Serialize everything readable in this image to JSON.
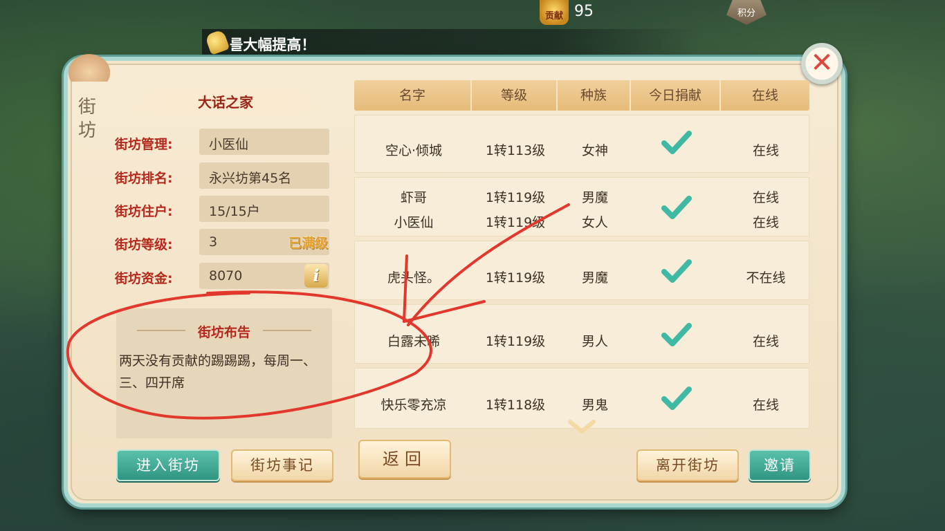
{
  "top": {
    "contribution_icon_label": "贡献",
    "contribution_value": "95",
    "score_icon_label": "积分"
  },
  "broadcast": {
    "text": "를大幅提高！"
  },
  "panel": {
    "side_title": "街坊",
    "home_name": "大话之家",
    "info": [
      {
        "label": "街坊管理:",
        "value": "小医仙"
      },
      {
        "label": "街坊排名:",
        "value": "永兴坊第45名"
      },
      {
        "label": "街坊住户:",
        "value": "15/15户"
      },
      {
        "label": "街坊等级:",
        "value": "3",
        "tag": "已满级"
      },
      {
        "label": "街坊资金:",
        "value": "8070",
        "icon": "i"
      }
    ],
    "notice": {
      "title": "街坊布告",
      "body": "两天没有贡献的踢踢踢，每周一、三、四开席"
    },
    "buttons": {
      "enter": "进入街坊",
      "log": "街坊事记",
      "back": "返回",
      "leave": "离开街坊",
      "invite": "邀请"
    },
    "close_icon": "✕"
  },
  "table": {
    "headers": [
      "名字",
      "等级",
      "种族",
      "今日捐献",
      "在线"
    ],
    "rows": [
      {
        "names": [
          "空心·倾城"
        ],
        "levels": [
          "1转113级"
        ],
        "races": [
          "女神"
        ],
        "donated": true,
        "status": [
          "在线"
        ]
      },
      {
        "names": [
          "虾哥",
          "小医仙"
        ],
        "levels": [
          "1转119级",
          "1转119级"
        ],
        "races": [
          "男魔",
          "女人"
        ],
        "donated": true,
        "status": [
          "在线",
          "在线"
        ]
      },
      {
        "names": [
          "虎头怪。"
        ],
        "levels": [
          "1转119级"
        ],
        "races": [
          "男魔"
        ],
        "donated": true,
        "status": [
          "不在线"
        ]
      },
      {
        "names": [
          "白露未晞"
        ],
        "levels": [
          "1转119级"
        ],
        "races": [
          "男人"
        ],
        "donated": true,
        "status": [
          "在线"
        ]
      },
      {
        "names": [
          "快乐零充凉"
        ],
        "levels": [
          "1转118级"
        ],
        "races": [
          "男鬼"
        ],
        "donated": true,
        "status": [
          "在线"
        ]
      }
    ]
  },
  "colors": {
    "panel_border": "#a8d8cf",
    "label_red": "#b5281c",
    "check_teal": "#3fb9a3",
    "annotation_red": "#e2372d"
  }
}
